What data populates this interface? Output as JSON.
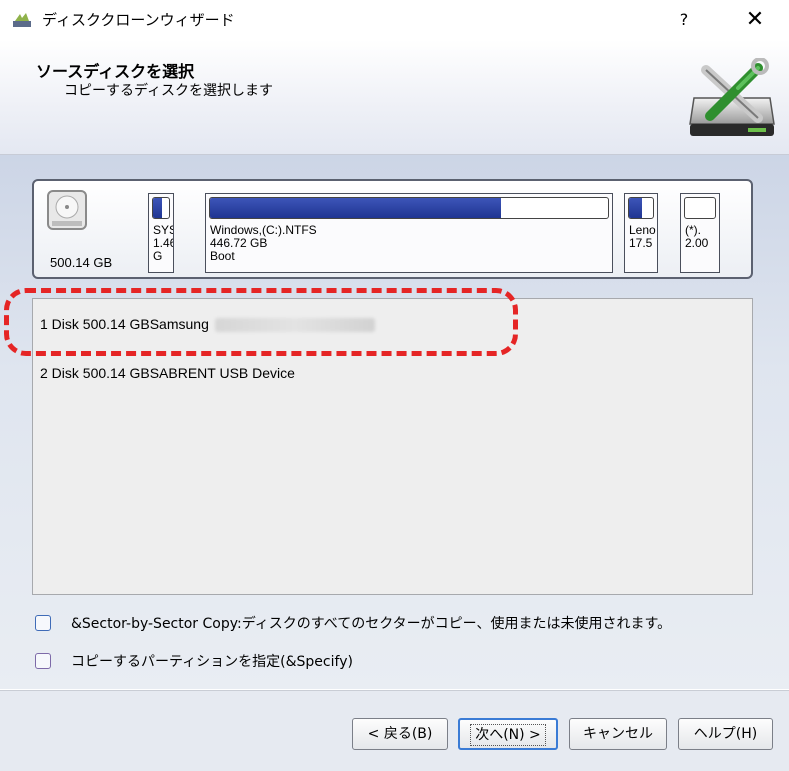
{
  "window": {
    "title": "ディスククローンウィザード",
    "help_glyph": "?",
    "close_glyph": "✕"
  },
  "header": {
    "title": "ソースディスクを選択",
    "subtitle": "コピーするディスクを選択します"
  },
  "disk_map": {
    "disk_size": "500.14 GB",
    "partitions": [
      {
        "label": "SYS\n1.46\nG",
        "used_fraction": 0.55
      },
      {
        "label": "Windows,(C:).NTFS\n446.72 GB\nBoot",
        "used_fraction": 0.73
      },
      {
        "label": "Leno\n17.5",
        "used_fraction": 0.55
      },
      {
        "label": "(*).\n2.00",
        "used_fraction": 0.0
      }
    ]
  },
  "disk_list": {
    "items": [
      {
        "label": "1 Disk 500.14 GBSamsung",
        "redacted": true
      },
      {
        "label": "2 Disk 500.14 GBSABRENT   USB Device",
        "redacted": false
      }
    ]
  },
  "options": {
    "sector_copy": {
      "label": "&Sector-by-Sector Copy:ディスクのすべてのセクターがコピー、使用または未使用されます。",
      "checked": false
    },
    "specify_partition": {
      "label": "コピーするパーティションを指定(&Specify)",
      "checked": false
    }
  },
  "footer": {
    "back": "< 戻る(B)",
    "next": "次へ(N) >",
    "cancel": "キャンセル",
    "help": "ヘルプ(H)"
  },
  "colors": {
    "accent": "#3a7bd5",
    "bar_fill": "#1f3592",
    "highlight": "#e52525"
  }
}
